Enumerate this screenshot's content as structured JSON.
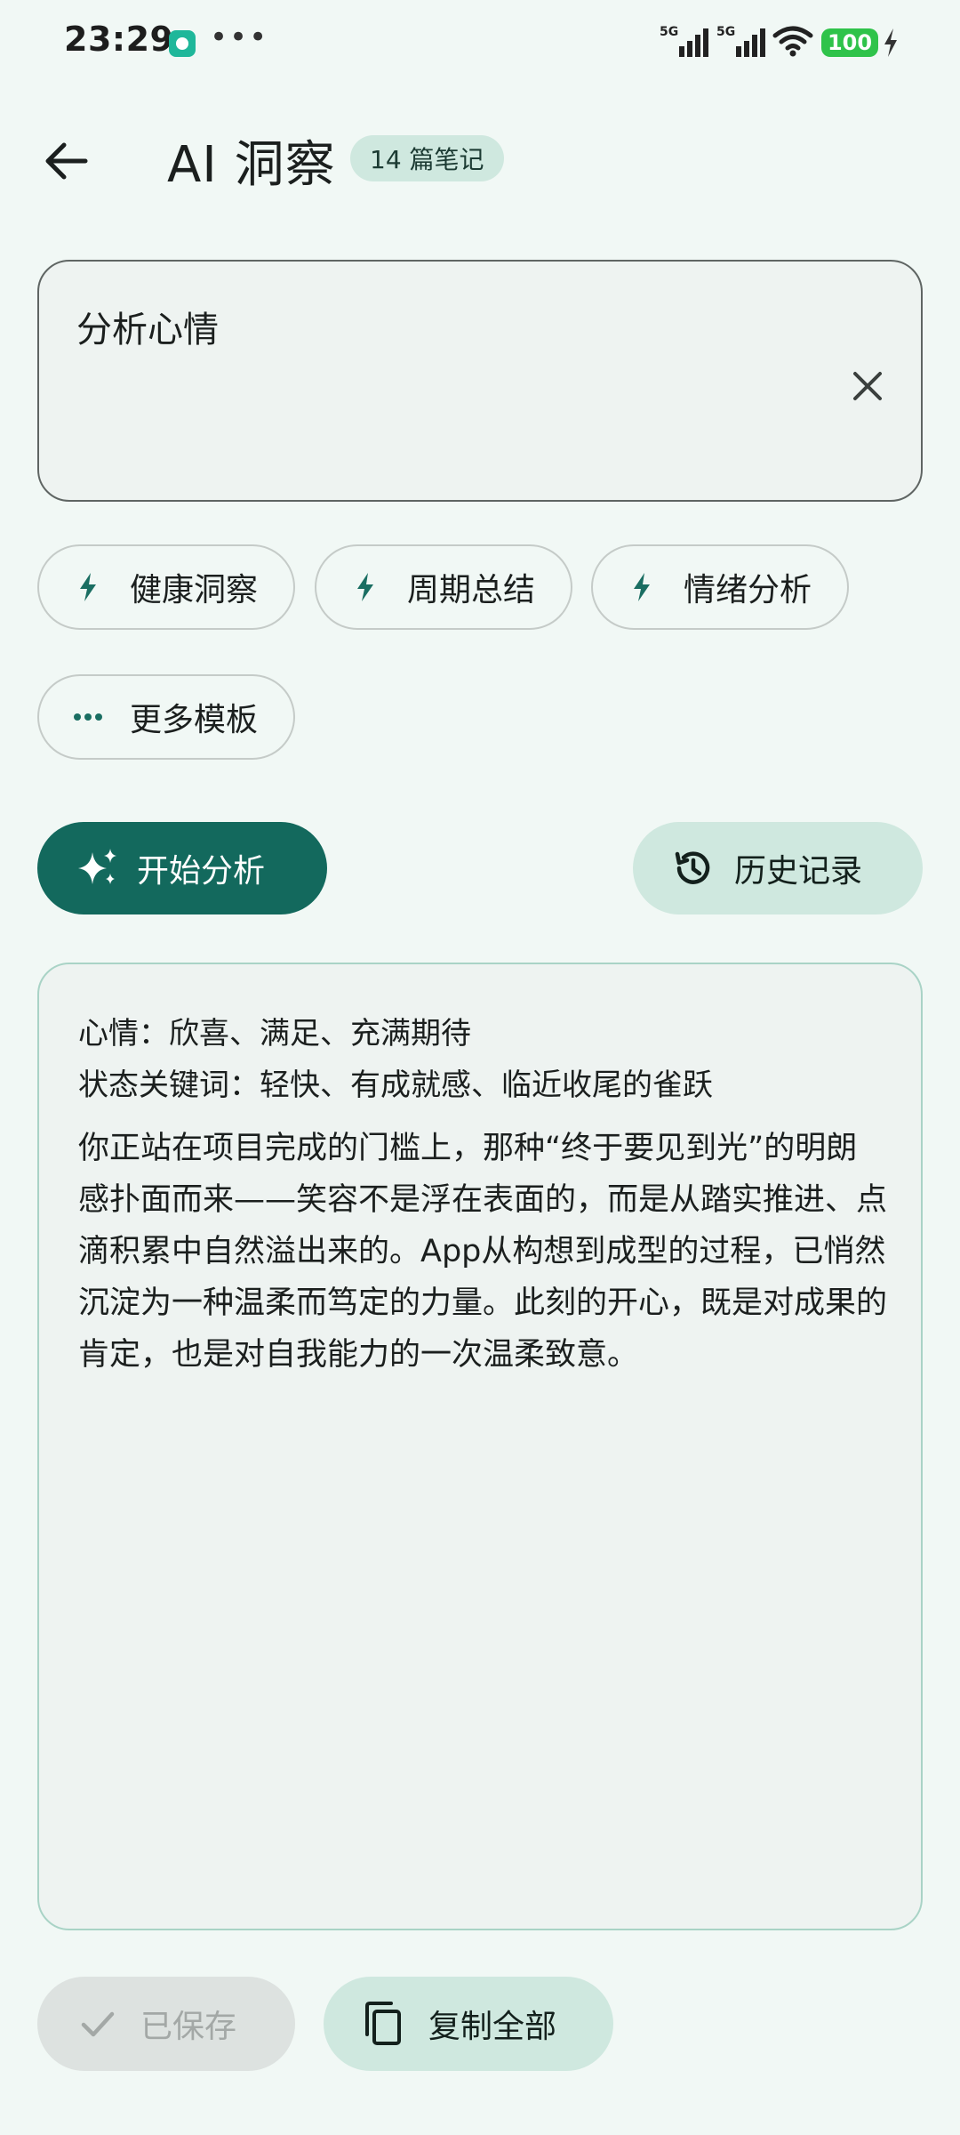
{
  "status_bar": {
    "time": "23:29",
    "dots": "•••",
    "signal1_label": "5G",
    "signal2_label": "5G",
    "battery": "100"
  },
  "header": {
    "title": "AI 洞察",
    "badge": "14 篇笔记"
  },
  "prompt": {
    "value": "分析心情"
  },
  "chips": [
    {
      "label": "健康洞察",
      "icon": "bolt-icon"
    },
    {
      "label": "周期总结",
      "icon": "bolt-icon"
    },
    {
      "label": "情绪分析",
      "icon": "bolt-icon"
    },
    {
      "label": "更多模板",
      "icon": "more-dots-icon"
    }
  ],
  "actions": {
    "start_label": "开始分析",
    "history_label": "历史记录"
  },
  "result": {
    "line1": "心情：欣喜、满足、充满期待",
    "line2": "状态关键词：轻快、有成就感、临近收尾的雀跃",
    "body": "你正站在项目完成的门槛上，那种“终于要见到光”的明朗感扑面而来——笑容不是浮在表面的，而是从踏实推进、点滴积累中自然溢出来的。App从构想到成型的过程，已悄然沉淀为一种温柔而笃定的力量。此刻的开心，既是对成果的肯定，也是对自我能力的一次温柔致意。"
  },
  "bottom": {
    "saved_label": "已保存",
    "copy_label": "复制全部"
  },
  "colors": {
    "background": "#f1f8f5",
    "primary": "#13695d",
    "tonal": "#cfe8df",
    "accent_icon": "#1a6e62"
  }
}
